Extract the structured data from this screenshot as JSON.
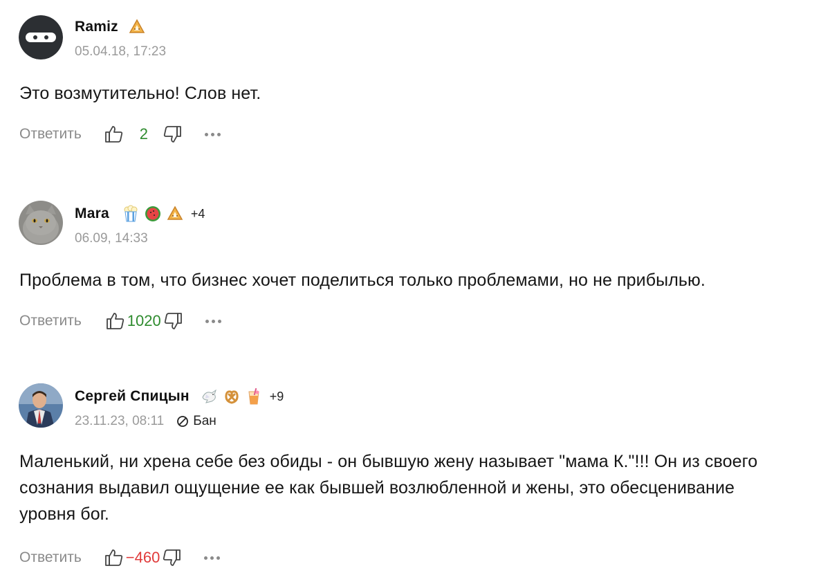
{
  "comments": [
    {
      "author": "Ramiz",
      "date": "05.04.18, 17:23",
      "text": "Это возмутительно! Слов нет.",
      "reply_label": "Ответить",
      "score": "2",
      "badges": [
        "bagel-badge-icon"
      ],
      "extra_badges": ""
    },
    {
      "author": "Mara",
      "date": "06.09, 14:33",
      "text": "Проблема в том, что бизнес хочет поделиться только проблемами, но не прибылью.",
      "reply_label": "Ответить",
      "score": "1020",
      "badges": [
        "popcorn-badge-icon",
        "watermelon-badge-icon",
        "bagel-badge-icon"
      ],
      "extra_badges": "+4"
    },
    {
      "author": "Сергей Спицын",
      "date": "23.11.23, 08:11",
      "status": "Бан",
      "text": "Маленький, ни хрена себе без обиды - он бывшую жену называет \"мама К.\"!!! Он из своего сознания выдавил ощущение ее как бывшей возлюбленной и жены, это обесценивание уровня бог.",
      "reply_label": "Ответить",
      "score": "−460",
      "badges": [
        "dove-badge-icon",
        "pretzel-badge-icon",
        "drink-badge-icon"
      ],
      "extra_badges": "+9"
    }
  ],
  "colors": {
    "positive": "#2e8b2e",
    "negative": "#e03a3a",
    "muted": "#8a8a8a"
  }
}
